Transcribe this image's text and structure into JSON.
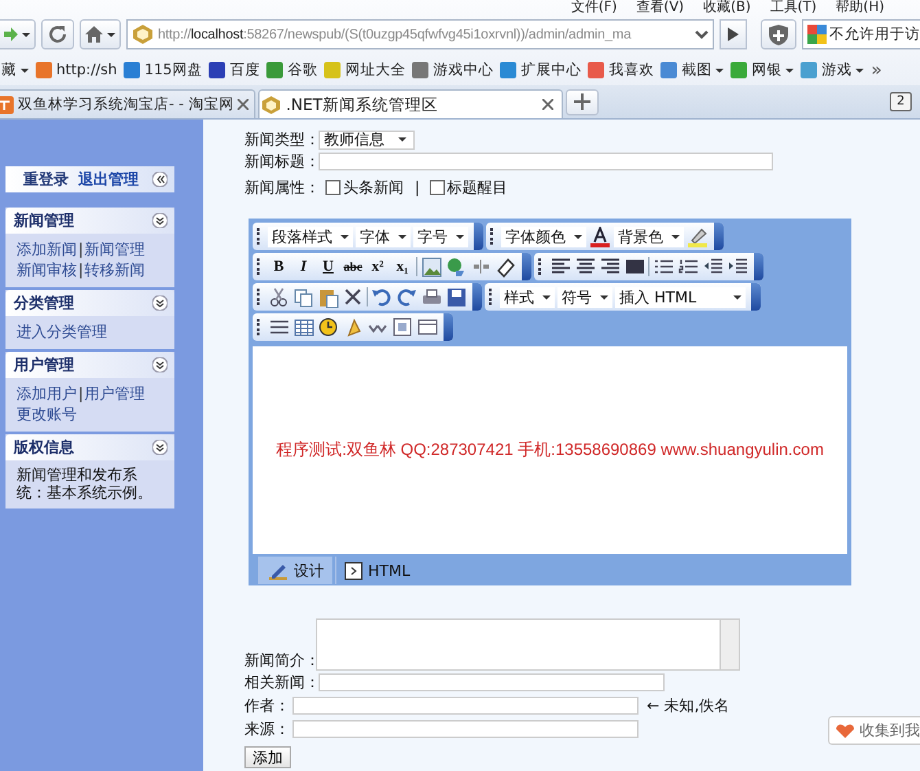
{
  "menu": [
    "文件(F)",
    "查看(V)",
    "收藏(B)",
    "工具(T)",
    "帮助(H)"
  ],
  "address": {
    "url": "http://localhost:58267/newspub/(S(t0uzgp45qfwfvg45i1oxrvnl))/admin/admin_ma",
    "search": "不允许用于访"
  },
  "bookmarks": [
    {
      "label": "藏",
      "menu": true
    },
    {
      "label": "http://sh",
      "menu": false
    },
    {
      "label": "115网盘",
      "menu": false
    },
    {
      "label": "百度",
      "menu": false
    },
    {
      "label": "谷歌",
      "menu": false
    },
    {
      "label": "网址大全",
      "menu": false
    },
    {
      "label": "游戏中心",
      "menu": false
    },
    {
      "label": "扩展中心",
      "menu": false
    },
    {
      "label": "我喜欢",
      "menu": false
    },
    {
      "label": "截图",
      "menu": true
    },
    {
      "label": "网银",
      "menu": true
    },
    {
      "label": "游戏",
      "menu": true
    }
  ],
  "more": "»",
  "tabs": [
    {
      "label": "双鱼林学习系统淘宝店- - 淘宝网",
      "selected": false
    },
    {
      "label": ".NET新闻系统管理区",
      "selected": true
    }
  ],
  "tab_count": "2",
  "sidebar": {
    "top_links": [
      "重登录",
      "退出管理"
    ],
    "separator": "|",
    "sections": [
      {
        "title": "新闻管理",
        "lines": [
          [
            "添加新闻",
            "新闻管理"
          ],
          [
            "新闻审核",
            "转移新闻"
          ]
        ]
      },
      {
        "title": "分类管理",
        "lines": [
          [
            "进入分类管理"
          ]
        ]
      },
      {
        "title": "用户管理",
        "lines": [
          [
            "添加用户",
            "用户管理"
          ],
          [
            "更改账号"
          ]
        ]
      },
      {
        "title": "版权信息",
        "text": "新闻管理和发布系统：基本系统示例。"
      }
    ]
  },
  "form": {
    "type_label": "新闻类型：",
    "type_value": "教师信息",
    "title_label": "新闻标题：",
    "attr_label": "新闻属性：",
    "attr_separator": "|",
    "attributes": [
      {
        "label": "头条新闻",
        "checked": false
      },
      {
        "label": "标题醒目",
        "checked": false
      }
    ]
  },
  "editor": {
    "toolbars": [
      [
        [
          {
            "kind": "dropdown",
            "label": "段落样式"
          },
          {
            "kind": "dropdown",
            "label": "字体"
          },
          {
            "kind": "dropdown",
            "label": "字号"
          }
        ],
        [
          {
            "kind": "dropdown",
            "label": "字体颜色"
          },
          {
            "kind": "fontcolor"
          },
          {
            "kind": "dropdown",
            "label": "背景色"
          },
          {
            "kind": "highlight"
          }
        ]
      ],
      [
        [
          {
            "kind": "glyph",
            "label": "B"
          },
          {
            "kind": "glyph",
            "label": "I"
          },
          {
            "kind": "glyph",
            "label": "U"
          },
          {
            "kind": "glyph",
            "label": "abc"
          },
          {
            "kind": "glyph",
            "label": "x²"
          },
          {
            "kind": "glyph",
            "label": "x₁"
          },
          {
            "kind": "sep"
          },
          {
            "kind": "image"
          },
          {
            "kind": "link"
          },
          {
            "kind": "unlink"
          },
          {
            "kind": "eraser"
          }
        ],
        [
          {
            "kind": "alignleft"
          },
          {
            "kind": "aligncenter"
          },
          {
            "kind": "alignright"
          },
          {
            "kind": "justify"
          },
          {
            "kind": "sep"
          },
          {
            "kind": "ulist"
          },
          {
            "kind": "olist"
          },
          {
            "kind": "outdent"
          },
          {
            "kind": "indent"
          }
        ]
      ],
      [
        [
          {
            "kind": "cut"
          },
          {
            "kind": "copy"
          },
          {
            "kind": "paste"
          },
          {
            "kind": "delete"
          },
          {
            "kind": "sep"
          },
          {
            "kind": "undo"
          },
          {
            "kind": "redo"
          },
          {
            "kind": "print"
          },
          {
            "kind": "save"
          }
        ],
        [
          {
            "kind": "dropdown",
            "label": "样式"
          },
          {
            "kind": "dropdown",
            "label": "符号"
          },
          {
            "kind": "dropdown",
            "label": "插入 HTML"
          }
        ]
      ],
      [
        [
          {
            "kind": "rule"
          },
          {
            "kind": "table"
          },
          {
            "kind": "clock"
          },
          {
            "kind": "special"
          },
          {
            "kind": "spell"
          },
          {
            "kind": "template"
          },
          {
            "kind": "grid"
          }
        ]
      ]
    ],
    "content": "程序测试:双鱼林 QQ:287307421 手机:13558690869 www.shuangyulin.com",
    "modes": [
      {
        "label": "设计",
        "kind": "design",
        "selected": true
      },
      {
        "label": "HTML",
        "kind": "html",
        "selected": false
      }
    ]
  },
  "lower": {
    "summary_label": "新闻简介：",
    "related_label": "相关新闻：",
    "author_label": "作者：",
    "author_hint": "← 未知,佚名",
    "source_label": "来源：",
    "submit": "添加"
  },
  "collect": "收集到我"
}
